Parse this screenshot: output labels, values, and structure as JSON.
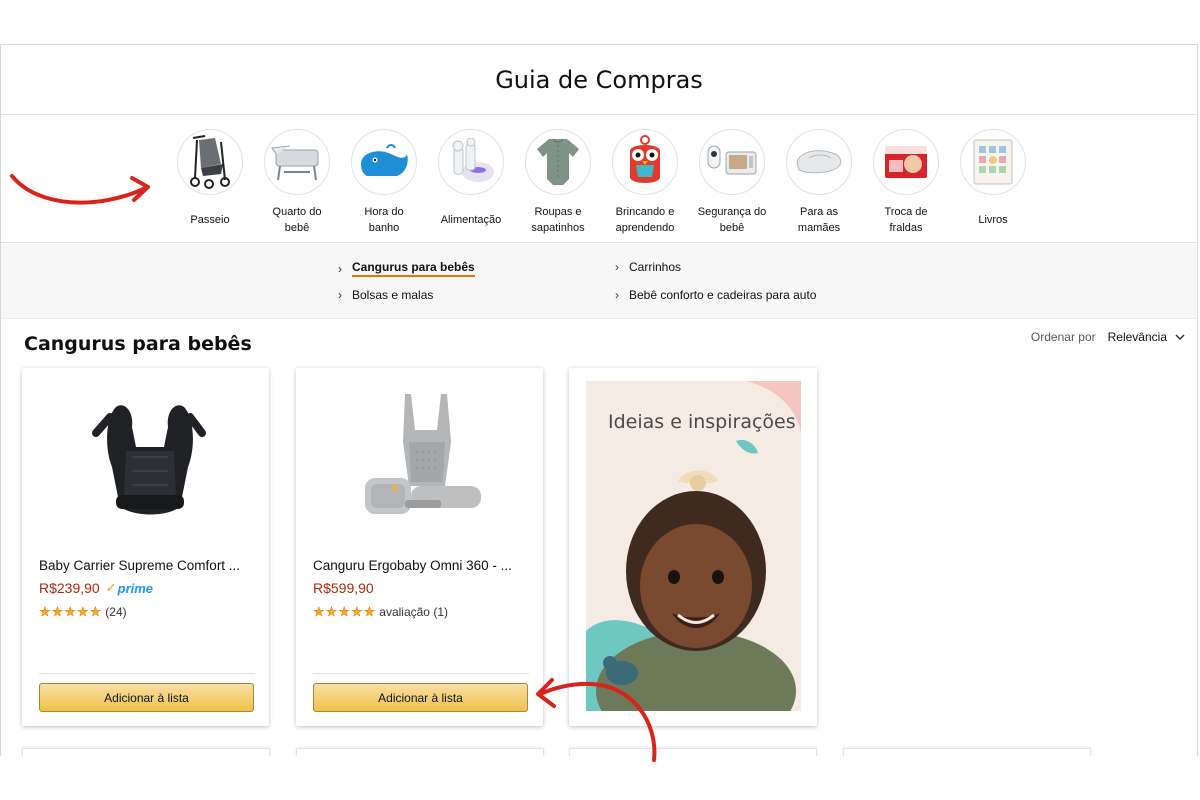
{
  "page": {
    "title": "Guia de Compras",
    "accent_color": "#e77600",
    "price_color": "#b12704"
  },
  "categories": [
    {
      "label": "Passeio",
      "icon": "stroller-icon",
      "active": true
    },
    {
      "label": "Quarto do bebê",
      "icon": "bassinet-icon",
      "active": false
    },
    {
      "label": "Hora do banho",
      "icon": "whale-bath-toy-icon",
      "active": false
    },
    {
      "label": "Alimentação",
      "icon": "breast-pump-icon",
      "active": false
    },
    {
      "label": "Roupas e sapatinhos",
      "icon": "baby-bodysuit-icon",
      "active": false
    },
    {
      "label": "Brincando e aprendendo",
      "icon": "owl-toy-icon",
      "active": false
    },
    {
      "label": "Segurança do bebê",
      "icon": "baby-monitor-icon",
      "active": false
    },
    {
      "label": "Para as mamães",
      "icon": "nursing-pillow-icon",
      "active": false
    },
    {
      "label": "Troca de fraldas",
      "icon": "diaper-pack-icon",
      "active": false
    },
    {
      "label": "Livros",
      "icon": "photo-book-icon",
      "active": false
    }
  ],
  "subnav": {
    "links": [
      {
        "label": "Cangurus para bebês",
        "active": true
      },
      {
        "label": "Bolsas e malas",
        "active": false
      },
      {
        "label": "Carrinhos",
        "active": false
      },
      {
        "label": "Bebê conforto e cadeiras para auto",
        "active": false
      }
    ]
  },
  "section": {
    "title": "Cangurus para bebês",
    "sort_label": "Ordenar por",
    "sort_value": "Relevância"
  },
  "products": [
    {
      "title": "Baby Carrier Supreme Comfort ...",
      "price": "R$239,90",
      "prime": "prime",
      "stars": 5,
      "review_text": "(24)",
      "button": "Adicionar à lista",
      "image": "black-baby-carrier-icon"
    },
    {
      "title": "Canguru Ergobaby Omni 360 - ...",
      "price": "R$599,90",
      "prime": "",
      "stars": 5,
      "review_text": "avaliação (1)",
      "button": "Adicionar à lista",
      "image": "grey-ergobaby-carrier-icon"
    }
  ],
  "inspiration": {
    "title": "Ideias e inspirações",
    "image": "smiling-baby-photo"
  }
}
